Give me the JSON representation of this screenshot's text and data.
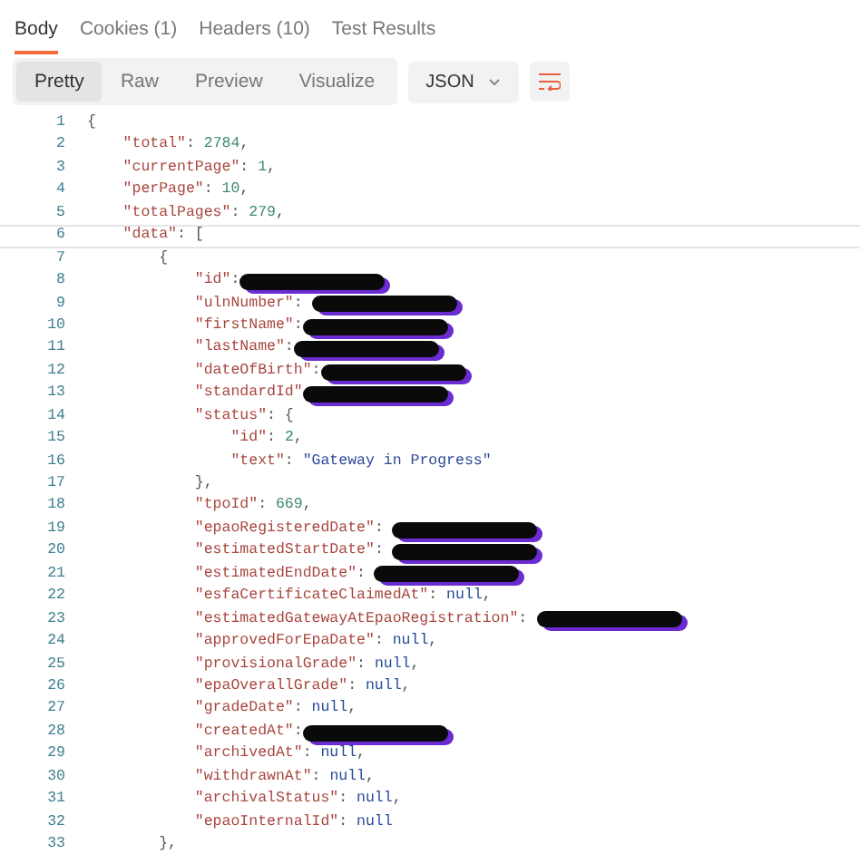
{
  "tabs": [
    {
      "label": "Body",
      "selected": true
    },
    {
      "label": "Cookies (1)",
      "selected": false
    },
    {
      "label": "Headers (10)",
      "selected": false
    },
    {
      "label": "Test Results",
      "selected": false
    }
  ],
  "views": [
    {
      "label": "Pretty",
      "selected": true
    },
    {
      "label": "Raw",
      "selected": false
    },
    {
      "label": "Preview",
      "selected": false
    },
    {
      "label": "Visualize",
      "selected": false
    }
  ],
  "format": {
    "value": "JSON"
  },
  "lines": [
    {
      "number": "1",
      "current": false,
      "tokens": [
        {
          "kind": "punct",
          "text": "{"
        }
      ]
    },
    {
      "number": "2",
      "current": false,
      "tokens": [
        {
          "kind": "key",
          "text": "    \"total\""
        },
        {
          "kind": "punct",
          "text": ": "
        },
        {
          "kind": "number",
          "text": "2784"
        },
        {
          "kind": "punct",
          "text": ","
        }
      ]
    },
    {
      "number": "3",
      "current": false,
      "tokens": [
        {
          "kind": "key",
          "text": "    \"currentPage\""
        },
        {
          "kind": "punct",
          "text": ": "
        },
        {
          "kind": "number",
          "text": "1"
        },
        {
          "kind": "punct",
          "text": ","
        }
      ]
    },
    {
      "number": "4",
      "current": false,
      "tokens": [
        {
          "kind": "key",
          "text": "    \"perPage\""
        },
        {
          "kind": "punct",
          "text": ": "
        },
        {
          "kind": "number",
          "text": "10"
        },
        {
          "kind": "punct",
          "text": ","
        }
      ]
    },
    {
      "number": "5",
      "current": false,
      "tokens": [
        {
          "kind": "key",
          "text": "    \"totalPages\""
        },
        {
          "kind": "punct",
          "text": ": "
        },
        {
          "kind": "number",
          "text": "279"
        },
        {
          "kind": "punct",
          "text": ","
        }
      ]
    },
    {
      "number": "6",
      "current": true,
      "tokens": [
        {
          "kind": "key",
          "text": "    \"data\""
        },
        {
          "kind": "punct",
          "text": ": ["
        }
      ]
    },
    {
      "number": "7",
      "current": false,
      "tokens": [
        {
          "kind": "punct",
          "text": "        {"
        }
      ]
    },
    {
      "number": "8",
      "current": false,
      "tokens": [
        {
          "kind": "key",
          "text": "            \"id\""
        },
        {
          "kind": "punct",
          "text": ":"
        },
        {
          "kind": "redaction"
        }
      ]
    },
    {
      "number": "9",
      "current": false,
      "tokens": [
        {
          "kind": "key",
          "text": "            \"ulnNumber\""
        },
        {
          "kind": "punct",
          "text": ": "
        },
        {
          "kind": "redaction"
        }
      ]
    },
    {
      "number": "10",
      "current": false,
      "tokens": [
        {
          "kind": "key",
          "text": "            \"firstName\""
        },
        {
          "kind": "punct",
          "text": ":"
        },
        {
          "kind": "redaction"
        }
      ]
    },
    {
      "number": "11",
      "current": false,
      "tokens": [
        {
          "kind": "key",
          "text": "            \"lastName\""
        },
        {
          "kind": "punct",
          "text": ":"
        },
        {
          "kind": "redaction"
        }
      ]
    },
    {
      "number": "12",
      "current": false,
      "tokens": [
        {
          "kind": "key",
          "text": "            \"dateOfBirth\""
        },
        {
          "kind": "punct",
          "text": ":"
        },
        {
          "kind": "redaction"
        }
      ]
    },
    {
      "number": "13",
      "current": false,
      "tokens": [
        {
          "kind": "key",
          "text": "            \"standardId\""
        },
        {
          "kind": "redaction"
        }
      ]
    },
    {
      "number": "14",
      "current": false,
      "tokens": [
        {
          "kind": "key",
          "text": "            \"status\""
        },
        {
          "kind": "punct",
          "text": ": {"
        }
      ]
    },
    {
      "number": "15",
      "current": false,
      "tokens": [
        {
          "kind": "key",
          "text": "                \"id\""
        },
        {
          "kind": "punct",
          "text": ": "
        },
        {
          "kind": "number",
          "text": "2"
        },
        {
          "kind": "punct",
          "text": ","
        }
      ]
    },
    {
      "number": "16",
      "current": false,
      "tokens": [
        {
          "kind": "key",
          "text": "                \"text\""
        },
        {
          "kind": "punct",
          "text": ": "
        },
        {
          "kind": "string",
          "text": "\"Gateway in Progress\""
        }
      ]
    },
    {
      "number": "17",
      "current": false,
      "tokens": [
        {
          "kind": "punct",
          "text": "            },"
        }
      ]
    },
    {
      "number": "18",
      "current": false,
      "tokens": [
        {
          "kind": "key",
          "text": "            \"tpoId\""
        },
        {
          "kind": "punct",
          "text": ": "
        },
        {
          "kind": "number",
          "text": "669"
        },
        {
          "kind": "punct",
          "text": ","
        }
      ]
    },
    {
      "number": "19",
      "current": false,
      "tokens": [
        {
          "kind": "key",
          "text": "            \"epaoRegisteredDate\""
        },
        {
          "kind": "punct",
          "text": ": "
        },
        {
          "kind": "redaction"
        }
      ]
    },
    {
      "number": "20",
      "current": false,
      "tokens": [
        {
          "kind": "key",
          "text": "            \"estimatedStartDate\""
        },
        {
          "kind": "punct",
          "text": ": "
        },
        {
          "kind": "redaction"
        }
      ]
    },
    {
      "number": "21",
      "current": false,
      "tokens": [
        {
          "kind": "key",
          "text": "            \"estimatedEndDate\""
        },
        {
          "kind": "punct",
          "text": ": "
        },
        {
          "kind": "redaction"
        }
      ]
    },
    {
      "number": "22",
      "current": false,
      "tokens": [
        {
          "kind": "key",
          "text": "            \"esfaCertificateClaimedAt\""
        },
        {
          "kind": "punct",
          "text": ": "
        },
        {
          "kind": "null",
          "text": "null"
        },
        {
          "kind": "punct",
          "text": ","
        }
      ]
    },
    {
      "number": "23",
      "current": false,
      "tokens": [
        {
          "kind": "key",
          "text": "            \"estimatedGatewayAtEpaoRegistration\""
        },
        {
          "kind": "punct",
          "text": ": "
        },
        {
          "kind": "redaction"
        }
      ]
    },
    {
      "number": "24",
      "current": false,
      "tokens": [
        {
          "kind": "key",
          "text": "            \"approvedForEpaDate\""
        },
        {
          "kind": "punct",
          "text": ": "
        },
        {
          "kind": "null",
          "text": "null"
        },
        {
          "kind": "punct",
          "text": ","
        }
      ]
    },
    {
      "number": "25",
      "current": false,
      "tokens": [
        {
          "kind": "key",
          "text": "            \"provisionalGrade\""
        },
        {
          "kind": "punct",
          "text": ": "
        },
        {
          "kind": "null",
          "text": "null"
        },
        {
          "kind": "punct",
          "text": ","
        }
      ]
    },
    {
      "number": "26",
      "current": false,
      "tokens": [
        {
          "kind": "key",
          "text": "            \"epaOverallGrade\""
        },
        {
          "kind": "punct",
          "text": ": "
        },
        {
          "kind": "null",
          "text": "null"
        },
        {
          "kind": "punct",
          "text": ","
        }
      ]
    },
    {
      "number": "27",
      "current": false,
      "tokens": [
        {
          "kind": "key",
          "text": "            \"gradeDate\""
        },
        {
          "kind": "punct",
          "text": ": "
        },
        {
          "kind": "null",
          "text": "null"
        },
        {
          "kind": "punct",
          "text": ","
        }
      ]
    },
    {
      "number": "28",
      "current": false,
      "tokens": [
        {
          "kind": "key",
          "text": "            \"createdAt\""
        },
        {
          "kind": "punct",
          "text": ":"
        },
        {
          "kind": "redaction"
        }
      ]
    },
    {
      "number": "29",
      "current": false,
      "tokens": [
        {
          "kind": "key",
          "text": "            \"archivedAt\""
        },
        {
          "kind": "punct",
          "text": ": "
        },
        {
          "kind": "null",
          "text": "null"
        },
        {
          "kind": "punct",
          "text": ","
        }
      ]
    },
    {
      "number": "30",
      "current": false,
      "tokens": [
        {
          "kind": "key",
          "text": "            \"withdrawnAt\""
        },
        {
          "kind": "punct",
          "text": ": "
        },
        {
          "kind": "null",
          "text": "null"
        },
        {
          "kind": "punct",
          "text": ","
        }
      ]
    },
    {
      "number": "31",
      "current": false,
      "tokens": [
        {
          "kind": "key",
          "text": "            \"archivalStatus\""
        },
        {
          "kind": "punct",
          "text": ": "
        },
        {
          "kind": "null",
          "text": "null"
        },
        {
          "kind": "punct",
          "text": ","
        }
      ]
    },
    {
      "number": "32",
      "current": false,
      "tokens": [
        {
          "kind": "key",
          "text": "            \"epaoInternalId\""
        },
        {
          "kind": "punct",
          "text": ": "
        },
        {
          "kind": "null",
          "text": "null"
        }
      ]
    },
    {
      "number": "33",
      "current": false,
      "tokens": [
        {
          "kind": "punct",
          "text": "        },"
        }
      ]
    }
  ]
}
